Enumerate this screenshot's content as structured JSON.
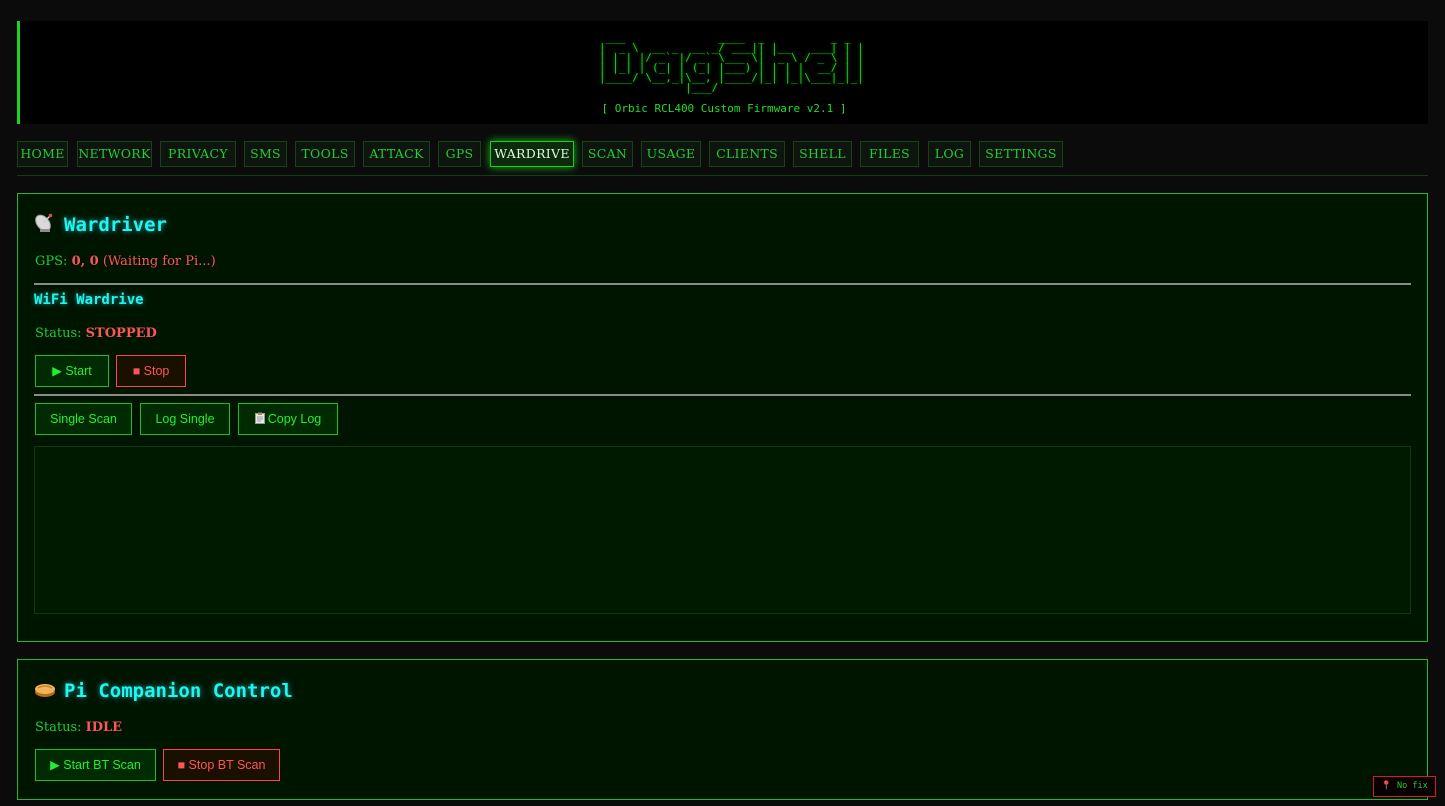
{
  "header": {
    "ascii_logo": " ___              ____  _          _ _ \n|  _ \\  __ _  __ _/ ___|| |__   ___| | |\n| | | |/ _` |/ _` \\___ \\| '_ \\ / _ \\ | |\n| |_| | (_| | (_| |___) | | | |  __/ | |\n|____/ \\__,_|\\__, |____/|_| |_|\\___|_|_|\n             |___/                      ",
    "subtitle": "[ Orbic RCL400 Custom Firmware v2.1 ]"
  },
  "nav": {
    "items": [
      {
        "label": "HOME"
      },
      {
        "label": "NETWORK"
      },
      {
        "label": "PRIVACY"
      },
      {
        "label": "SMS"
      },
      {
        "label": "TOOLS"
      },
      {
        "label": "ATTACK"
      },
      {
        "label": "GPS"
      },
      {
        "label": "WARDRIVE"
      },
      {
        "label": "SCAN"
      },
      {
        "label": "USAGE"
      },
      {
        "label": "CLIENTS"
      },
      {
        "label": "SHELL"
      },
      {
        "label": "FILES"
      },
      {
        "label": "LOG"
      },
      {
        "label": "SETTINGS"
      }
    ],
    "active": "WARDRIVE"
  },
  "wardriver": {
    "title": "Wardriver",
    "icon": "satellite-dish-icon",
    "gps_label": "GPS:",
    "gps_value": "0, 0",
    "gps_note": "(Waiting for Pi...)",
    "wifi_title": "WiFi Wardrive",
    "status_label": "Status:",
    "status_value": "STOPPED",
    "start_label": "▶ Start",
    "stop_label": "■ Stop",
    "single_scan_label": "Single Scan",
    "log_single_label": "Log Single",
    "copy_log_label": "Copy Log",
    "log_content": ""
  },
  "pi_companion": {
    "title": "Pi Companion Control",
    "icon": "pie-icon",
    "status_label": "Status:",
    "status_value": "IDLE",
    "start_bt_label": "▶ Start BT Scan",
    "stop_bt_label": "■ Stop BT Scan"
  },
  "gps_badge": {
    "icon": "pin-icon",
    "label": "No fix"
  },
  "colors": {
    "accent_green": "#22dd33",
    "title_cyan": "#21f5f0",
    "alert_red": "#ff5555"
  }
}
